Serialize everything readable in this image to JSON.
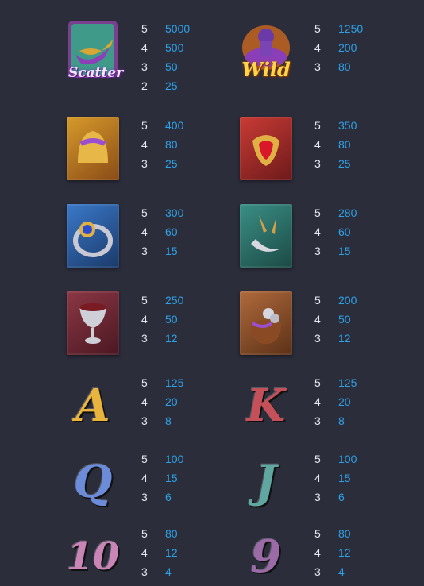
{
  "paytable": {
    "rows": [
      {
        "left": {
          "icon": "scatter-lamp-icon",
          "label": "Scatter",
          "pays": [
            {
              "count": "5",
              "value": "5000"
            },
            {
              "count": "4",
              "value": "500"
            },
            {
              "count": "3",
              "value": "50"
            },
            {
              "count": "2",
              "value": "25"
            }
          ]
        },
        "right": {
          "icon": "wild-genie-icon",
          "label": "Wild",
          "pays": [
            {
              "count": "5",
              "value": "1250"
            },
            {
              "count": "4",
              "value": "200"
            },
            {
              "count": "3",
              "value": "80"
            }
          ]
        }
      },
      {
        "left": {
          "icon": "gold-helmet-icon",
          "pays": [
            {
              "count": "5",
              "value": "400"
            },
            {
              "count": "4",
              "value": "80"
            },
            {
              "count": "3",
              "value": "25"
            }
          ]
        },
        "right": {
          "icon": "ruby-pendant-icon",
          "pays": [
            {
              "count": "5",
              "value": "350"
            },
            {
              "count": "4",
              "value": "80"
            },
            {
              "count": "3",
              "value": "25"
            }
          ]
        }
      },
      {
        "left": {
          "icon": "sapphire-ring-icon",
          "pays": [
            {
              "count": "5",
              "value": "300"
            },
            {
              "count": "4",
              "value": "60"
            },
            {
              "count": "3",
              "value": "15"
            }
          ]
        },
        "right": {
          "icon": "daggers-icon",
          "pays": [
            {
              "count": "5",
              "value": "280"
            },
            {
              "count": "4",
              "value": "60"
            },
            {
              "count": "3",
              "value": "15"
            }
          ]
        }
      },
      {
        "left": {
          "icon": "chalice-icon",
          "pays": [
            {
              "count": "5",
              "value": "250"
            },
            {
              "count": "4",
              "value": "50"
            },
            {
              "count": "3",
              "value": "12"
            }
          ]
        },
        "right": {
          "icon": "coin-pouch-icon",
          "pays": [
            {
              "count": "5",
              "value": "200"
            },
            {
              "count": "4",
              "value": "50"
            },
            {
              "count": "3",
              "value": "12"
            }
          ]
        }
      },
      {
        "left": {
          "icon": "letter-a-icon",
          "glyph": "A",
          "pays": [
            {
              "count": "5",
              "value": "125"
            },
            {
              "count": "4",
              "value": "20"
            },
            {
              "count": "3",
              "value": "8"
            }
          ]
        },
        "right": {
          "icon": "letter-k-icon",
          "glyph": "K",
          "pays": [
            {
              "count": "5",
              "value": "125"
            },
            {
              "count": "4",
              "value": "20"
            },
            {
              "count": "3",
              "value": "8"
            }
          ]
        }
      },
      {
        "left": {
          "icon": "letter-q-icon",
          "glyph": "Q",
          "pays": [
            {
              "count": "5",
              "value": "100"
            },
            {
              "count": "4",
              "value": "15"
            },
            {
              "count": "3",
              "value": "6"
            }
          ]
        },
        "right": {
          "icon": "letter-j-icon",
          "glyph": "J",
          "pays": [
            {
              "count": "5",
              "value": "100"
            },
            {
              "count": "4",
              "value": "15"
            },
            {
              "count": "3",
              "value": "6"
            }
          ]
        }
      },
      {
        "left": {
          "icon": "number-10-icon",
          "glyph": "10",
          "pays": [
            {
              "count": "5",
              "value": "80"
            },
            {
              "count": "4",
              "value": "12"
            },
            {
              "count": "3",
              "value": "4"
            }
          ]
        },
        "right": {
          "icon": "number-9-icon",
          "glyph": "9",
          "pays": [
            {
              "count": "5",
              "value": "80"
            },
            {
              "count": "4",
              "value": "12"
            },
            {
              "count": "3",
              "value": "4"
            }
          ]
        }
      }
    ]
  }
}
